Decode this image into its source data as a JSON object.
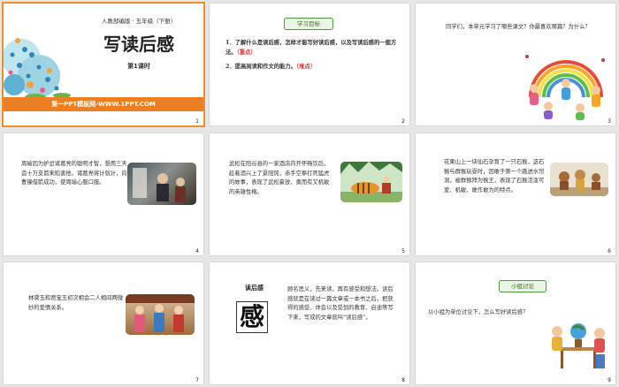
{
  "colors": {
    "accent": "#ea7f24",
    "tag_green": "#4a9a3a",
    "background": "#e6e6e6"
  },
  "slides": [
    {
      "number": "1",
      "top_line": "人教部编版 · 五年级（下册）",
      "title": "写读后感",
      "subtitle": "第1课时",
      "banner": "第一PPT模板网-WWW.1PPT.COM"
    },
    {
      "number": "2",
      "tag": "学习目标",
      "goal_1": "1．了解什么是读后感，怎样才能写好读后感，以及写读后感的一般方法。",
      "goal_1_mark": "（重点）",
      "goal_2": "2．提高阅读和作文的能力。",
      "goal_2_mark": "（难点）"
    },
    {
      "number": "3",
      "text": "同学们，本单元学习了哪些课文？你最喜欢哪篇？为什么？"
    },
    {
      "number": "4",
      "text": "周瑜因为妒忌诸葛亮的聪明才智，想用三天造十万支箭来陷害他，诸葛亮将计就计，向曹操借箭成功，使周瑜心服口服。"
    },
    {
      "number": "5",
      "text": "武松在阳谷县的一家酒店内开怀畅饮后，趁着酒兴上了景阳冈，赤手空拳打死猛虎的故事，表现了武松豪放、勇而有又机敏的英雄性格。"
    },
    {
      "number": "6",
      "text": "花果山上一块仙石孕育了一只石猴，这石猴与群猴玩耍时，因敢于第一个跳进水帘洞，被群猴拜为猴王，表现了石猴活泼可爱、机敏、敢作敢为的特点。"
    },
    {
      "number": "7",
      "text": "林黛玉和贾宝玉初次相会二人相间两微妙的爱情关系。"
    },
    {
      "number": "8",
      "heading": "读后感",
      "glyph": "感",
      "text": "顾名思义，先来读，再有感受和想法。读后感就是在读过一篇文章或一本书之后，把获得的感受、体会以及受到的教育、启迪等写下来，写成的文章就叫“读后感”。"
    },
    {
      "number": "9",
      "tag": "小组讨论",
      "text": "以小组为单位讨论下，怎么写好读后感？"
    }
  ]
}
